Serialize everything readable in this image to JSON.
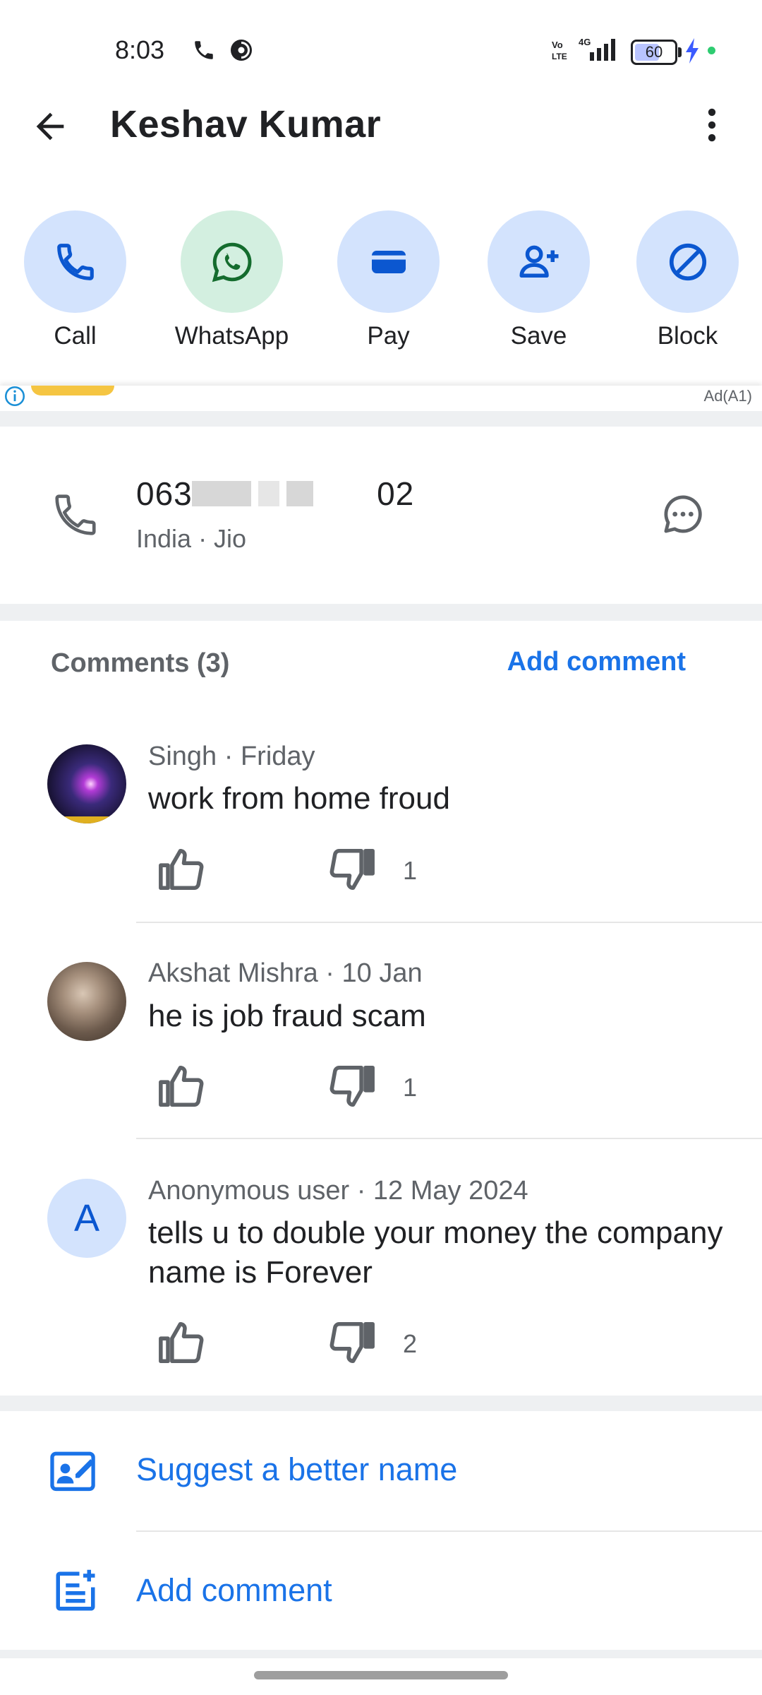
{
  "status_bar": {
    "time": "8:03",
    "battery": "60"
  },
  "header": {
    "title": "Keshav Kumar"
  },
  "actions": [
    {
      "label": "Call"
    },
    {
      "label": "WhatsApp"
    },
    {
      "label": "Pay"
    },
    {
      "label": "Save"
    },
    {
      "label": "Block"
    }
  ],
  "ad": {
    "label": "Ad(A1)"
  },
  "contact": {
    "number_start": "063",
    "number_end": "02",
    "subtitle": "India · Jio"
  },
  "comments": {
    "header": "Comments (3)",
    "add_label": "Add comment",
    "items": [
      {
        "author": "Singh",
        "date": "Friday",
        "meta": "Singh · Friday",
        "text": "work from home froud",
        "dislikes": "1"
      },
      {
        "author": "Akshat Mishra",
        "date": "10 Jan",
        "meta": "Akshat Mishra · 10 Jan",
        "text": "he is job fraud scam",
        "dislikes": "1"
      },
      {
        "author": "Anonymous user",
        "date": "12 May 2024",
        "meta": "Anonymous user · 12 May 2024",
        "initial": "A",
        "text": "tells u to double your money the company name is Forever",
        "dislikes": "2"
      }
    ]
  },
  "bottom_actions": {
    "suggest_name": "Suggest a better name",
    "add_comment": "Add comment"
  },
  "colors": {
    "accent": "#1a73e8",
    "chip_blue": "#d3e3fd",
    "chip_green": "#d3efe0",
    "icon_blue": "#0b57d0",
    "icon_green": "#146c2e"
  }
}
